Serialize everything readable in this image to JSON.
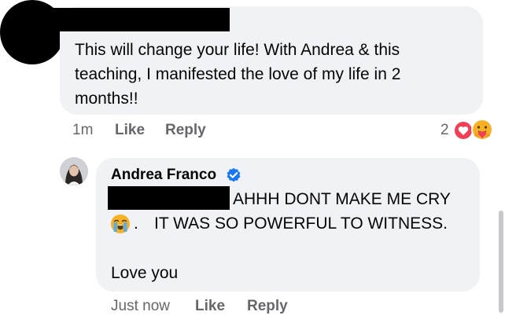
{
  "comment": {
    "text": "This will change your life!  With Andrea & this\nteaching, I manifested the love of my life in 2\nmonths!!",
    "time": "1m",
    "like_label": "Like",
    "reply_label": "Reply",
    "reaction_count": "2",
    "reaction_icons": [
      "love-icon",
      "care-icon"
    ]
  },
  "reply": {
    "author": "Andrea Franco",
    "verified": true,
    "line1": "AHHH DONT MAKE ME CRY",
    "line2_prefix": ".",
    "line2": "IT WAS SO POWERFUL TO WITNESS.",
    "line3": "Love you",
    "time": "Just now",
    "like_label": "Like",
    "reply_label": "Reply",
    "emoji_icon": "loudly-crying-face-icon"
  },
  "colors": {
    "bubble": "#f0f2f5",
    "meta_text": "#65676b",
    "text": "#050505",
    "verified_blue": "#1877f2",
    "love_red": "#f33e58",
    "emoji_yellow": "#f7b125"
  }
}
